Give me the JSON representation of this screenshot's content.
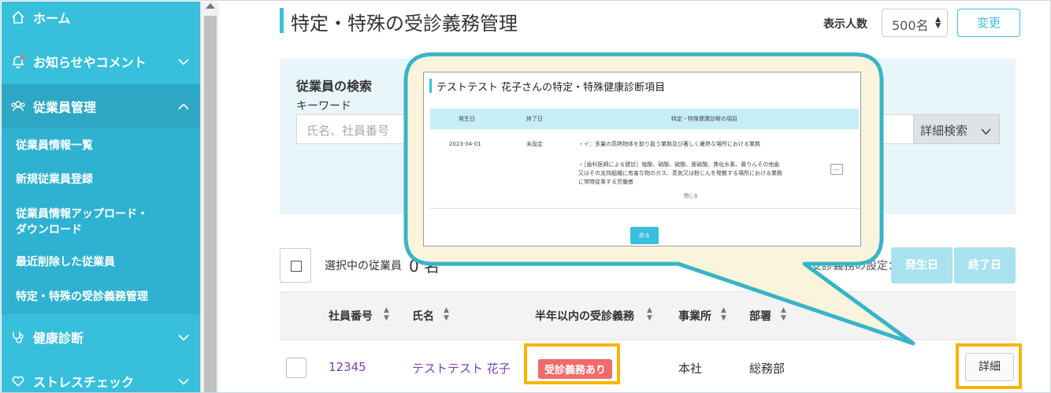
{
  "sidebar": {
    "home": "ホーム",
    "news": "お知らせやコメント",
    "employees": "従業員管理",
    "sub_items": [
      "従業員情報一覧",
      "新規従業員登録",
      "従業員情報アップロード・",
      "ダウンロード",
      "最近削除した従業員",
      "特定・特殊の受診義務管理"
    ],
    "health": "健康診断",
    "stress": "ストレスチェック"
  },
  "header": {
    "title": "特定・特殊の受診義務管理",
    "count_label": "表示人数",
    "count_value": "500名",
    "change_label": "変更"
  },
  "search": {
    "title": "従業員の検索",
    "keyword_label": "キーワード",
    "placeholder": "氏名、社員番号",
    "advanced_label": "詳細検索"
  },
  "selection": {
    "label": "選択中の従業員",
    "count": "0",
    "unit": "名",
    "setting_label": "受診義務の設定：",
    "start_label": "発生日",
    "end_label": "終了日"
  },
  "table": {
    "headers": [
      "社員番号",
      "氏名",
      "半年以内の受診義務",
      "事業所",
      "部署"
    ],
    "row": {
      "id": "12345",
      "name": "テストテスト 花子",
      "badge": "受診義務あり",
      "office": "本社",
      "dept": "総務部",
      "detail_label": "詳細"
    }
  },
  "popup": {
    "title": "テストテスト 花子さんの特定・特殊健康診断項目",
    "headers": [
      "発生日",
      "終了日",
      "特定・特殊健康診断の項目"
    ],
    "start": "2023-04-01",
    "end": "未設定",
    "item1": "・イ：多量の高熱物体を取り扱う業務及び著しく暑熱な場所における業務",
    "item2": "・［歯科医師による健診］塩酸、硝酸、硫酸、亜硫酸、弗化水素、黄りんその他歯又はその支持組織に有害な物のガス、蒸気又は粉じんを発散する場所における業務に常時従事する労働者",
    "more": "…",
    "close": "閉じる",
    "back": "戻る"
  },
  "colors": {
    "accent": "#38bfdc",
    "highlight": "#f7b500",
    "badge": "#ef6a6a",
    "link": "#7b3fb5"
  }
}
